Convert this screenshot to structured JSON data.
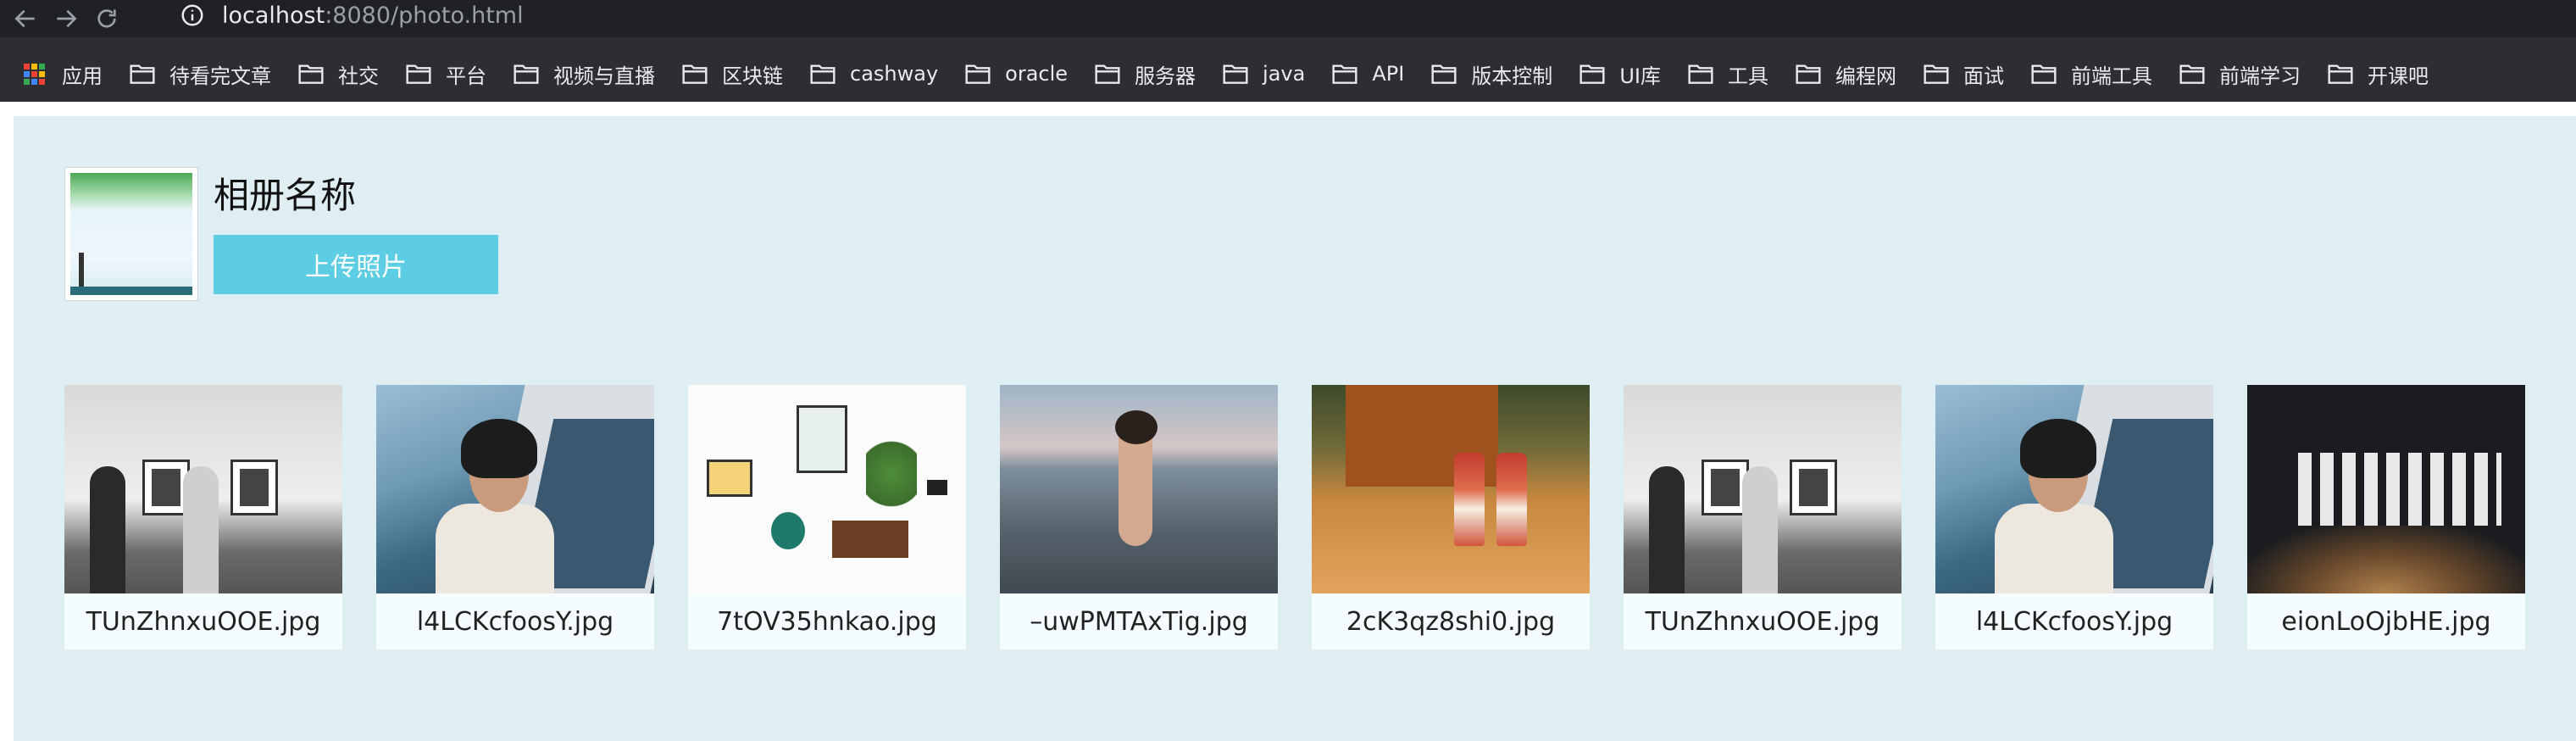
{
  "browser": {
    "url_host": "localhost",
    "url_rest": ":8080/photo.html",
    "bookmarks": [
      {
        "label": "应用",
        "icon": "apps-grid-icon"
      },
      {
        "label": "待看完文章",
        "icon": "folder-icon"
      },
      {
        "label": "社交",
        "icon": "folder-icon"
      },
      {
        "label": "平台",
        "icon": "folder-icon"
      },
      {
        "label": "视频与直播",
        "icon": "folder-icon"
      },
      {
        "label": "区块链",
        "icon": "folder-icon"
      },
      {
        "label": "cashway",
        "icon": "folder-icon"
      },
      {
        "label": "oracle",
        "icon": "folder-icon"
      },
      {
        "label": "服务器",
        "icon": "folder-icon"
      },
      {
        "label": "java",
        "icon": "folder-icon"
      },
      {
        "label": "API",
        "icon": "folder-icon"
      },
      {
        "label": "版本控制",
        "icon": "folder-icon"
      },
      {
        "label": "UI库",
        "icon": "folder-icon"
      },
      {
        "label": "工具",
        "icon": "folder-icon"
      },
      {
        "label": "编程网",
        "icon": "folder-icon"
      },
      {
        "label": "面试",
        "icon": "folder-icon"
      },
      {
        "label": "前端工具",
        "icon": "folder-icon"
      },
      {
        "label": "前端学习",
        "icon": "folder-icon"
      },
      {
        "label": "开课吧",
        "icon": "folder-icon"
      }
    ]
  },
  "album": {
    "title": "相册名称",
    "upload_label": "上传照片"
  },
  "photos": [
    {
      "name": "TUnZhnxuOOE.jpg"
    },
    {
      "name": "l4LCKcfoosY.jpg"
    },
    {
      "name": "7tOV35hnkao.jpg"
    },
    {
      "name": "–uwPMTAxTig.jpg"
    },
    {
      "name": "2cK3qz8shi0.jpg"
    },
    {
      "name": "TUnZhnxuOOE.jpg"
    },
    {
      "name": "l4LCKcfoosY.jpg"
    },
    {
      "name": "eionLoOjbHE.jpg"
    }
  ],
  "colors": {
    "panel_bg": "#dfeef3",
    "upload_button": "#5ccde3",
    "chrome_dark": "#202124"
  }
}
